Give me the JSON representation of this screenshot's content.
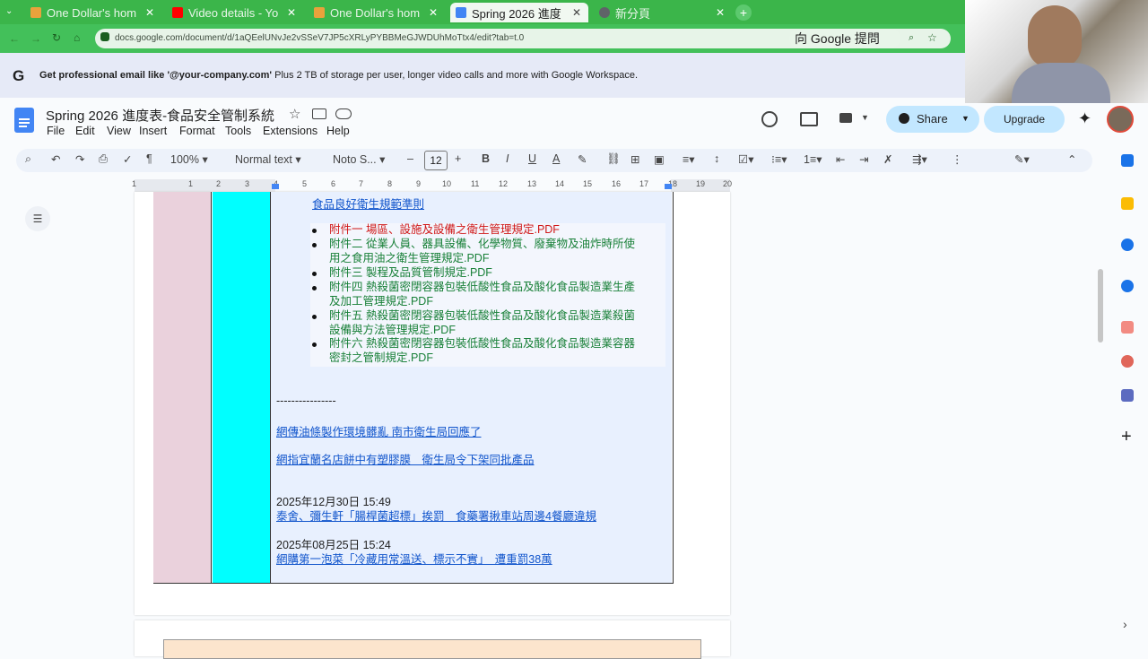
{
  "browser": {
    "tabs": [
      {
        "title": "One Dollar's hom",
        "favicon_color": "#e8a23c",
        "active": false
      },
      {
        "title": "Video details - Yo",
        "favicon_color": "#ff0000",
        "active": false
      },
      {
        "title": "One Dollar's hom",
        "favicon_color": "#e8a23c",
        "active": false
      },
      {
        "title": "Spring 2026 進度",
        "favicon_color": "#4285f4",
        "active": true
      },
      {
        "title": "新分頁",
        "favicon_color": "#5f6368",
        "active": false
      }
    ],
    "url": "docs.google.com/document/d/1aQEelUNvJe2vSSeV7JP5cXRLyPYBBMeGJWDUhMoTtx4/edit?tab=t.0",
    "ask_google": "向 Google 提問"
  },
  "promo": {
    "bold": "Get professional email like '@your-company.com'",
    "text": " Plus 2 TB of storage per user, longer video calls and more with Google Workspace."
  },
  "doc": {
    "title": "Spring 2026 進度表-食品安全管制系統",
    "menus": [
      "File",
      "Edit",
      "View",
      "Insert",
      "Format",
      "Tools",
      "Extensions",
      "Help"
    ],
    "share_label": "Share",
    "upgrade_label": "Upgrade"
  },
  "format_toolbar": {
    "zoom": "100%",
    "style": "Normal text",
    "font": "Noto S...",
    "font_size": "12",
    "bold": "B",
    "italic": "I",
    "underline": "U",
    "text_color": "A",
    "minus": "–",
    "plus": "+"
  },
  "ruler": {
    "numbers": [
      "1",
      "1",
      "2",
      "3",
      "4",
      "5",
      "6",
      "7",
      "8",
      "9",
      "10",
      "11",
      "12",
      "13",
      "14",
      "15",
      "16",
      "17",
      "18",
      "19",
      "20"
    ]
  },
  "content": {
    "top_link": "食品良好衛生規範準則",
    "attachments": [
      {
        "text_lines": [
          "附件一 場區、設施及設備之衛生管理規定.PDF"
        ],
        "color": "#d01818"
      },
      {
        "text_lines": [
          "附件二 從業人員、器具設備、化學物質、廢棄物及油炸時所使",
          "用之食用油之衛生管理規定.PDF"
        ],
        "color": "#188038"
      },
      {
        "text_lines": [
          "附件三 製程及品質管制規定.PDF"
        ],
        "color": "#188038"
      },
      {
        "text_lines": [
          "附件四 熱殺菌密閉容器包裝低酸性食品及酸化食品製造業生產",
          "及加工管理規定.PDF"
        ],
        "color": "#188038"
      },
      {
        "text_lines": [
          "附件五 熱殺菌密閉容器包裝低酸性食品及酸化食品製造業殺菌",
          "設備與方法管理規定.PDF"
        ],
        "color": "#188038"
      },
      {
        "text_lines": [
          "附件六 熱殺菌密閉容器包裝低酸性食品及酸化食品製造業容器",
          "密封之管制規定.PDF"
        ],
        "color": "#188038"
      }
    ],
    "divider": "----------------",
    "news1": "網傳油條製作環境髒亂 南市衛生局回應了",
    "news2": "網指宜蘭名店餅中有塑膠膜　衛生局令下架同批產品",
    "date1": "2025年12月30日 15:49",
    "news3": "泰舍、彌生軒「腸桿菌超標」挨罰　食藥署揪車站周邊4餐廳違規",
    "date2": "2025年08月25日 15:24",
    "news4": "網購第一泡菜「冷藏用常溫送、標示不實」　遭重罰38萬"
  }
}
